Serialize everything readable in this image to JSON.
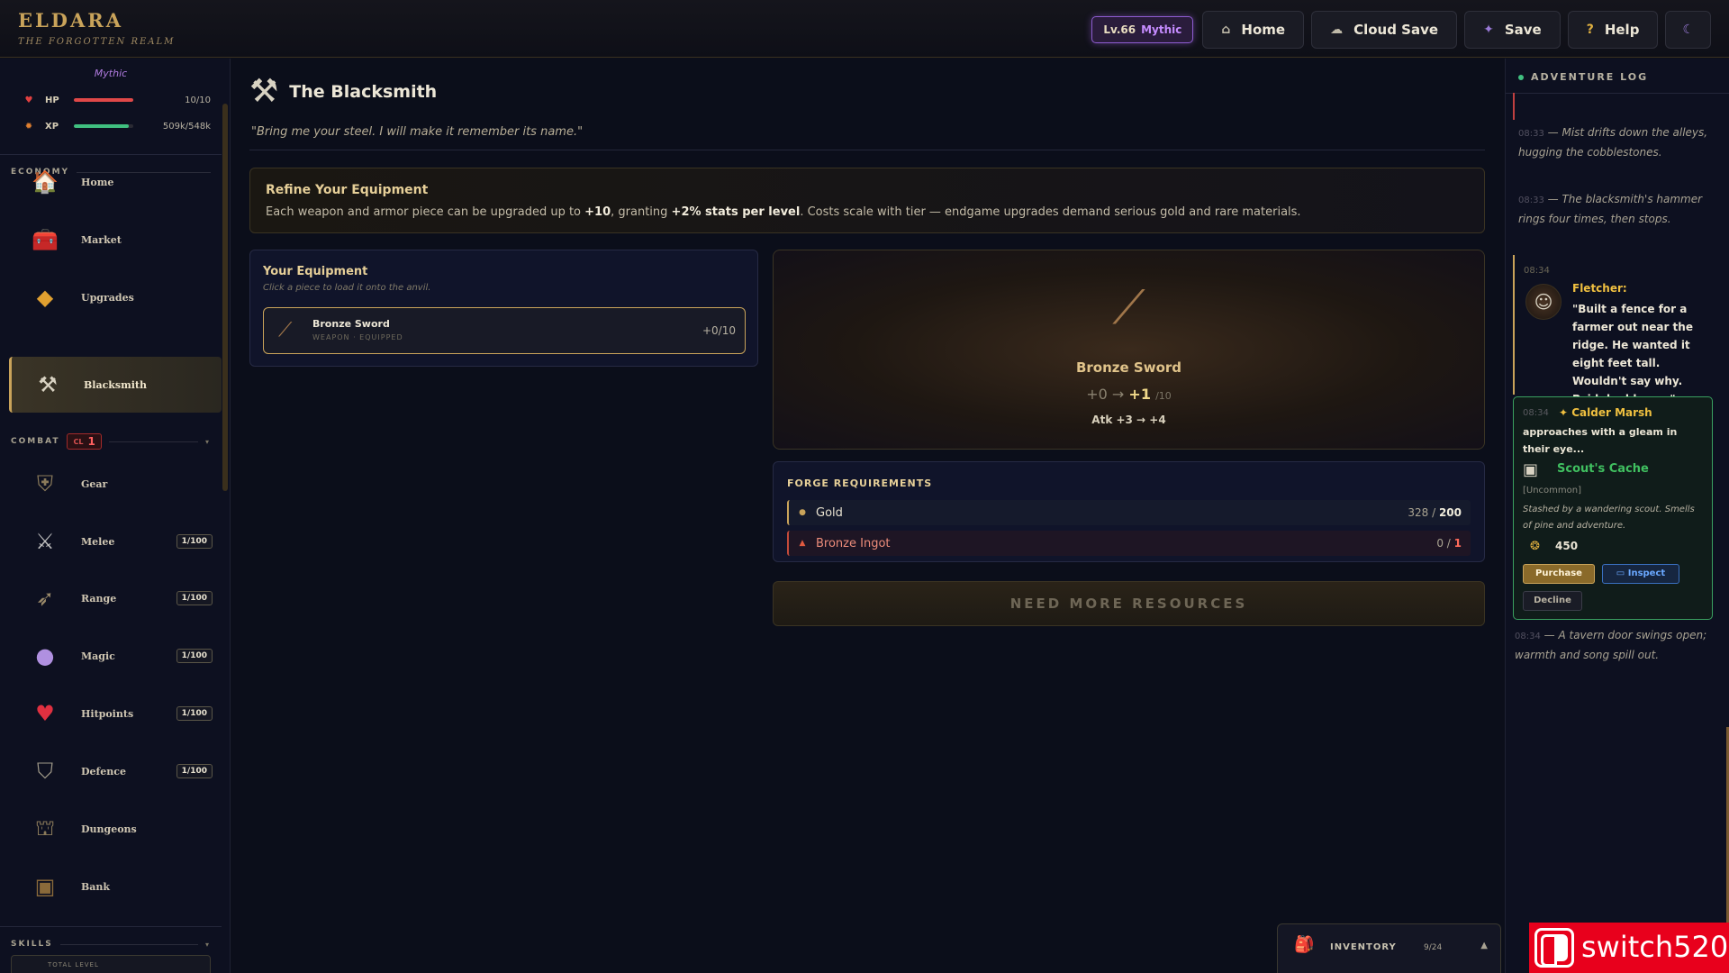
{
  "header": {
    "brand_title": "ELDARA",
    "brand_subtitle": "THE FORGOTTEN REALM",
    "level": "Lv.66",
    "tier": "Mythic",
    "buttons": [
      {
        "label": "Home",
        "icon": "house-icon"
      },
      {
        "label": "Cloud Save",
        "icon": "cloud-icon"
      },
      {
        "label": "Save",
        "icon": "save-icon"
      },
      {
        "label": "Help",
        "icon": "help-icon"
      }
    ]
  },
  "sidebar": {
    "tier": "Mythic",
    "hp": {
      "label": "HP",
      "value": "10/10",
      "fraction": 1.0
    },
    "xp": {
      "label": "XP",
      "value": "509k/548k",
      "fraction": 0.93
    },
    "economy": {
      "label": "ECONOMY",
      "items": [
        {
          "label": "Home",
          "icon": "house-icon"
        },
        {
          "label": "Market",
          "icon": "chest-icon"
        },
        {
          "label": "Upgrades",
          "icon": "crystal-icon"
        },
        {
          "label": "Blacksmith",
          "icon": "anvil-icon",
          "active": true
        }
      ]
    },
    "combat": {
      "label": "COMBAT",
      "cl_label": "CL",
      "cl_value": "1",
      "items": [
        {
          "label": "Gear",
          "icon": "shield-icon",
          "count": ""
        },
        {
          "label": "Melee",
          "icon": "crossed-swords-icon",
          "count": "1/100"
        },
        {
          "label": "Range",
          "icon": "bow-icon",
          "count": "1/100"
        },
        {
          "label": "Magic",
          "icon": "orb-icon",
          "count": "1/100"
        },
        {
          "label": "Hitpoints",
          "icon": "heart-icon",
          "count": "1/100"
        },
        {
          "label": "Defence",
          "icon": "defence-shield-icon",
          "count": "1/100"
        },
        {
          "label": "Dungeons",
          "icon": "dungeon-icon",
          "count": ""
        },
        {
          "label": "Bank",
          "icon": "bank-chest-icon",
          "count": ""
        }
      ]
    },
    "skills": {
      "label": "SKILLS",
      "total_level_label": "TOTAL LEVEL"
    }
  },
  "main": {
    "title": "The Blacksmith",
    "quote": "\"Bring me your steel. I will make it remember its name.\"",
    "refine": {
      "title": "Refine Your Equipment",
      "text_1": "Each weapon and armor piece can be upgraded up to ",
      "bold_1": "+10",
      "text_2": ", granting ",
      "bold_2": "+2% stats per level",
      "text_3": ". Costs scale with tier — endgame upgrades demand serious gold and rare materials."
    },
    "equipment": {
      "title": "Your Equipment",
      "hint": "Click a piece to load it onto the anvil.",
      "items": [
        {
          "name": "Bronze Sword",
          "sub": "WEAPON · EQUIPPED",
          "level": "+0/10",
          "icon": "sword-icon"
        }
      ]
    },
    "anvil": {
      "item_name": "Bronze Sword",
      "from": "+0",
      "arrow": "→",
      "to": "+1",
      "max": "/10",
      "stat": "Atk +3 → +4"
    },
    "requirements": {
      "title": "FORGE REQUIREMENTS",
      "items": [
        {
          "name": "Gold",
          "have": "328 / ",
          "need": "200"
        },
        {
          "name": "Bronze Ingot",
          "have": "0 / ",
          "need": "1"
        }
      ]
    },
    "forge_button": "NEED MORE RESOURCES"
  },
  "log": {
    "title": "ADVENTURE LOG",
    "entries": [
      {
        "time": "08:33",
        "text": "Mist drifts down the alleys, hugging the cobblestones."
      },
      {
        "time": "08:33",
        "text": "The blacksmith's hammer rings four times, then stops."
      }
    ],
    "fletcher": {
      "time": "08:34",
      "name": "Fletcher:",
      "text": "\"Built a fence for a farmer out near the ridge. He wanted it eight feet tall. Wouldn't say why. Paid double, so.\""
    },
    "merchant": {
      "time": "08:34",
      "name": "✦ Calder Marsh",
      "text": "approaches with a gleam in their eye...",
      "item_name": "Scout's Cache",
      "rarity": "[Uncommon]",
      "desc": "Stashed by a wandering scout. Smells of pine and adventure.",
      "price": "450",
      "purchase": "Purchase",
      "inspect": "Inspect",
      "decline": "Decline"
    },
    "last": {
      "time": "08:34",
      "text": "A tavern door swings open; warmth and song spill out."
    }
  },
  "inventory": {
    "label": "INVENTORY",
    "count": "9/24"
  },
  "watermark": {
    "text": "switch520"
  }
}
